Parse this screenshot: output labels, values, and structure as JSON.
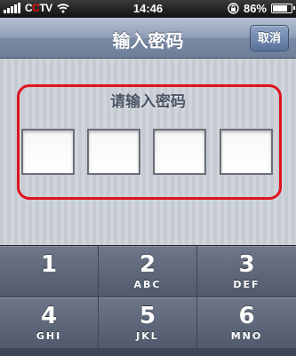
{
  "status_bar": {
    "carrier": "CCTV",
    "time": "14:46",
    "battery": "86%",
    "battery_level": 0.86
  },
  "nav": {
    "title": "输入密码",
    "cancel_label": "取消"
  },
  "passcode": {
    "prompt": "请输入密码",
    "digits_entered": 0,
    "box_count": 4
  },
  "keypad": {
    "keys": [
      {
        "digit": "1",
        "letters": ""
      },
      {
        "digit": "2",
        "letters": "ABC"
      },
      {
        "digit": "3",
        "letters": "DEF"
      },
      {
        "digit": "4",
        "letters": "GHI"
      },
      {
        "digit": "5",
        "letters": "JKL"
      },
      {
        "digit": "6",
        "letters": "MNO"
      }
    ]
  },
  "colors": {
    "highlight": "#e0121d",
    "nav_bar": "#8d9db5",
    "keypad": "#505a6c"
  }
}
